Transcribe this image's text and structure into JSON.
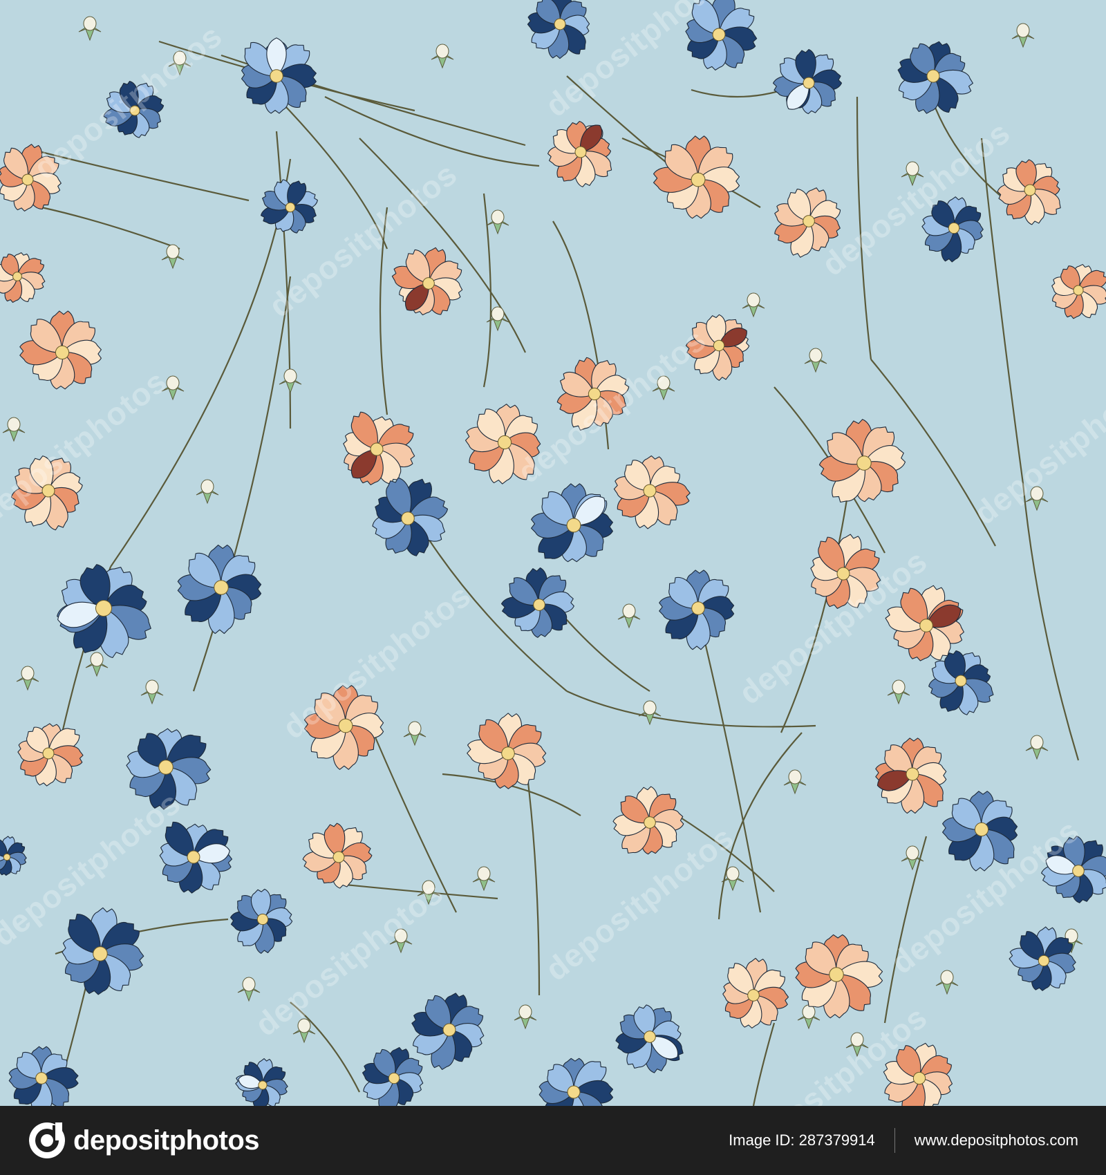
{
  "pattern": {
    "background_color": "#bcd7e0",
    "stem_color": "#5a5a3a",
    "bud_leaf_color": "#8fbf8a",
    "bud_color": "#f3f1e3",
    "flower_palettes": {
      "blue": [
        "#5f86b8",
        "#9cc0e6",
        "#1e3f6e",
        "#e6f2fb"
      ],
      "peach": [
        "#e9946d",
        "#f6c9a8",
        "#fbe4c8",
        "#8b3a2e"
      ]
    }
  },
  "watermark": {
    "text": "depositphotos"
  },
  "footer": {
    "brand_name": "depositphotos",
    "image_id": "Image ID: 287379914",
    "site_url": "www.depositphotos.com",
    "background_color": "#1f1f1f"
  }
}
